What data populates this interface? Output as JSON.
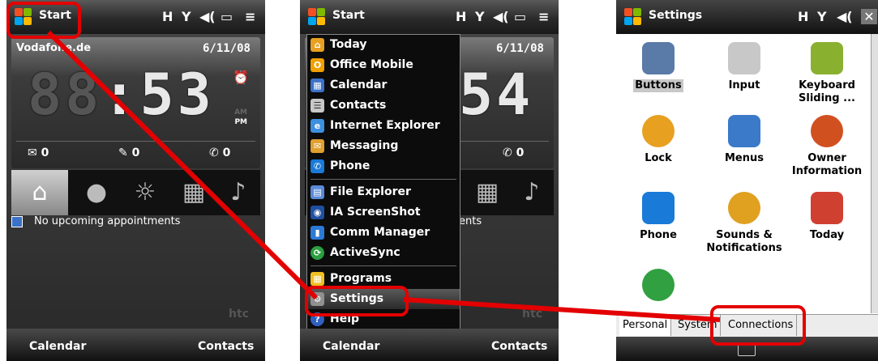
{
  "screen1": {
    "top_bar": {
      "start_label": "Start"
    },
    "carrier": "Vodafone.de",
    "date": "6/11/08",
    "clock": {
      "dim": "88",
      "time": ":53",
      "am": "AM",
      "pm": "PM"
    },
    "counters": [
      {
        "icon": "envelope-icon",
        "value": "0"
      },
      {
        "icon": "sms-icon",
        "value": "0"
      },
      {
        "icon": "phone-icon",
        "value": "0"
      }
    ],
    "tabs": [
      "home-icon",
      "person-icon",
      "weather-icon",
      "grid-icon",
      "music-icon"
    ],
    "appointment": "No upcoming appointments",
    "brand": "htc",
    "softkeys": {
      "left": "Calendar",
      "right": "Contacts"
    }
  },
  "screen2": {
    "top_bar": {
      "start_label": "Start"
    },
    "date": "6/11/08",
    "clock_partial": "54",
    "appt_partial": "ents",
    "brand": "htc",
    "menu_items": [
      {
        "label": "Today",
        "icon": "home-icon",
        "color": "#e8a020"
      },
      {
        "label": "Office Mobile",
        "icon": "office-icon",
        "color": "#f0a000"
      },
      {
        "label": "Calendar",
        "icon": "calendar-icon",
        "color": "#3b72c9"
      },
      {
        "label": "Contacts",
        "icon": "contacts-icon",
        "color": "#c8c8c8"
      },
      {
        "label": "Internet Explorer",
        "icon": "ie-icon",
        "color": "#3d8fe0"
      },
      {
        "label": "Messaging",
        "icon": "messaging-icon",
        "color": "#e0a030"
      },
      {
        "label": "Phone",
        "icon": "phone-icon",
        "color": "#1a7ad8"
      },
      {
        "label": "File Explorer",
        "icon": "folder-icon",
        "color": "#5a8ad8"
      },
      {
        "label": "IA ScreenShot",
        "icon": "camera-icon",
        "color": "#2050a0"
      },
      {
        "label": "Comm Manager",
        "icon": "comm-icon",
        "color": "#2b7ad8"
      },
      {
        "label": "ActiveSync",
        "icon": "sync-icon",
        "color": "#2aa040"
      },
      {
        "label": "Programs",
        "icon": "programs-icon",
        "color": "#f0c020"
      },
      {
        "label": "Settings",
        "icon": "settings-icon",
        "color": "#909090"
      },
      {
        "label": "Help",
        "icon": "help-icon",
        "color": "#3060c0"
      }
    ],
    "softkeys": {
      "left": "Calendar",
      "right": "Contacts"
    }
  },
  "screen3": {
    "title": "Settings",
    "items": [
      {
        "label": "Buttons",
        "icon": "buttons-icon",
        "color": "#5a7aa8"
      },
      {
        "label": "Input",
        "icon": "keyboard-icon",
        "color": "#c8c8c8"
      },
      {
        "label": "Keyboard Sliding ...",
        "icon": "keyboard-sliding-icon",
        "color": "#8ab030"
      },
      {
        "label": "Lock",
        "icon": "key-icon",
        "color": "#e8a020"
      },
      {
        "label": "Menus",
        "icon": "menus-icon",
        "color": "#3a7ac8"
      },
      {
        "label": "Owner Information",
        "icon": "owner-icon",
        "color": "#d05020"
      },
      {
        "label": "Phone",
        "icon": "phone-icon",
        "color": "#1a7ad8"
      },
      {
        "label": "Sounds & Notifications",
        "icon": "sounds-icon",
        "color": "#e0a020"
      },
      {
        "label": "Today",
        "icon": "today-icon",
        "color": "#d04030"
      },
      {
        "label": "",
        "icon": "voice-speed-dial-icon",
        "color": "#30a040"
      }
    ],
    "tabs": [
      "Personal",
      "System",
      "Connections"
    ]
  },
  "colors": {
    "highlight": "#e30000"
  }
}
